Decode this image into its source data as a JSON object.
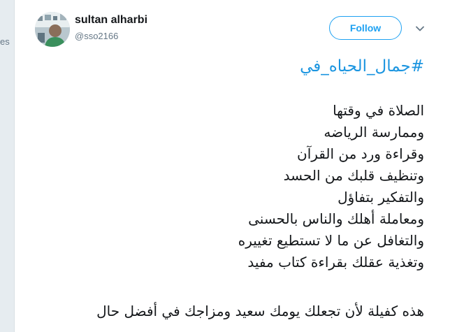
{
  "backdrop": {
    "cut_text": "es"
  },
  "tweet": {
    "user": {
      "name": "sultan alharbi",
      "handle": "@sso2166"
    },
    "follow_label": "Follow",
    "hashtag": "#جمال_الحياه_في",
    "lines": [
      "الصلاة في وقتها",
      "وممارسة الرياضه",
      "وقراءة ورد من القرآن",
      "وتنظيف قلبك من الحسد",
      "والتفكير بتفاؤل",
      "ومعاملة أهلك والناس بالحسنى",
      "والتغافل عن ما لا تستطيع تغييره",
      "وتغذية عقلك بقراءة كتاب مفيد"
    ],
    "closing": "هذه كفيلة لأن تجعلك يومك سعيد ومزاجك في أفضل حال"
  },
  "icons": {
    "more": "chevron-down-icon",
    "avatar": "profile-photo"
  },
  "colors": {
    "accent": "#1da1f2",
    "hashtag": "#1b95e0",
    "text": "#14171a",
    "muted": "#657786",
    "background": "#e6ecf0"
  }
}
